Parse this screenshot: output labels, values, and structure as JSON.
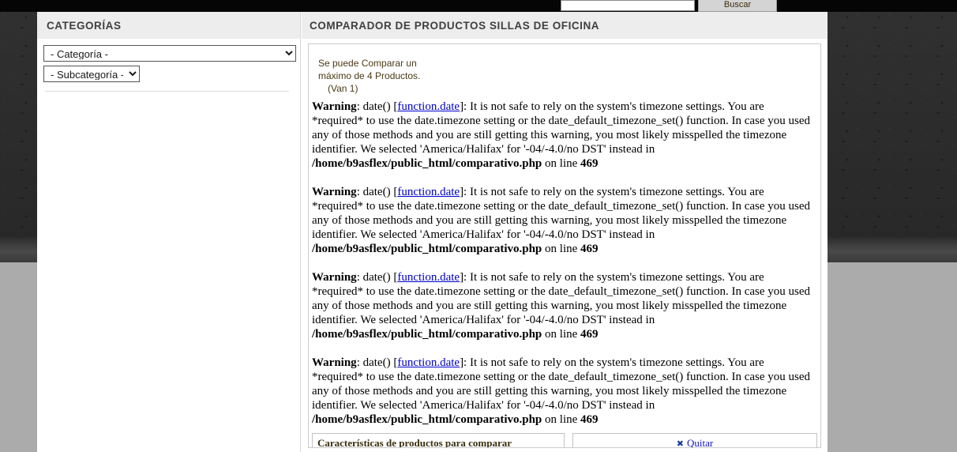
{
  "topbar": {
    "search_value": "",
    "search_placeholder": "",
    "search_button_label": "Buscar"
  },
  "sidebar": {
    "heading": "CATEGORÍAS",
    "category_select": {
      "selected": "- Categoría -"
    },
    "subcategory_select": {
      "selected": "- Subcategoría -"
    }
  },
  "content": {
    "heading": "COMPARADOR DE PRODUCTOS SILLAS DE OFICINA",
    "notice": {
      "line1": "Se puede Comparar un",
      "line2": "máximo de 4 Productos.",
      "line3": "(Van 1)"
    },
    "warnings": [
      {
        "label": "Warning",
        "fn": ": date() [",
        "link": "function.date",
        "body": "]: It is not safe to rely on the system's timezone settings. You are *required* to use the date.timezone setting or the date_default_timezone_set() function. In case you used any of those methods and you are still getting this warning, you most likely misspelled the timezone identifier. We selected 'America/Halifax' for '-04/-4.0/no DST' instead in ",
        "path": "/home/b9asflex/public_html/comparativo.php",
        "tail": " on line ",
        "line": "469"
      },
      {
        "label": "Warning",
        "fn": ": date() [",
        "link": "function.date",
        "body": "]: It is not safe to rely on the system's timezone settings. You are *required* to use the date.timezone setting or the date_default_timezone_set() function. In case you used any of those methods and you are still getting this warning, you most likely misspelled the timezone identifier. We selected 'America/Halifax' for '-04/-4.0/no DST' instead in ",
        "path": "/home/b9asflex/public_html/comparativo.php",
        "tail": " on line ",
        "line": "469"
      },
      {
        "label": "Warning",
        "fn": ": date() [",
        "link": "function.date",
        "body": "]: It is not safe to rely on the system's timezone settings. You are *required* to use the date.timezone setting or the date_default_timezone_set() function. In case you used any of those methods and you are still getting this warning, you most likely misspelled the timezone identifier. We selected 'America/Halifax' for '-04/-4.0/no DST' instead in ",
        "path": "/home/b9asflex/public_html/comparativo.php",
        "tail": " on line ",
        "line": "469"
      },
      {
        "label": "Warning",
        "fn": ": date() [",
        "link": "function.date",
        "body": "]: It is not safe to rely on the system's timezone settings. You are *required* to use the date.timezone setting or the date_default_timezone_set() function. In case you used any of those methods and you are still getting this warning, you most likely misspelled the timezone identifier. We selected 'America/Halifax' for '-04/-4.0/no DST' instead in ",
        "path": "/home/b9asflex/public_html/comparativo.php",
        "tail": " on line ",
        "line": "469"
      }
    ],
    "compare_table": {
      "features_header": "Características de productos para comparar",
      "remove_icon": "✖",
      "remove_label": "Quitar"
    }
  },
  "colors": {
    "panel_header_bg": "#ededed",
    "link_blue": "#0000cc",
    "remove_blue": "#1111cc",
    "page_bg_gray": "#ababab"
  }
}
